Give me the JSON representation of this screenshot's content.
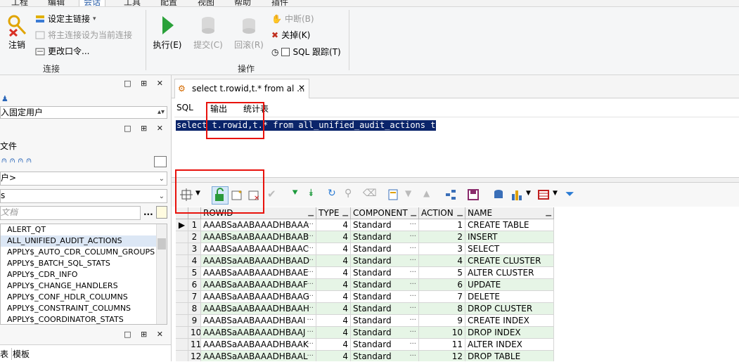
{
  "menu": [
    "工程",
    "编辑",
    "会话",
    "工具",
    "配置",
    "视图",
    "帮助",
    "插件"
  ],
  "menu_active": "会话",
  "ribbon": {
    "connection_group": "连接",
    "logoff": "注销",
    "set_primary": "设定主链接",
    "set_primary_as_current": "将主连接设为当前连接",
    "change_password": "更改口令...",
    "operations_group": "操作",
    "execute": "执行(E)",
    "commit": "提交(C)",
    "rollback": "回滚(R)",
    "break": "中断(B)",
    "close": "关掉(K)",
    "sql_trace": "SQL 跟踪(T)"
  },
  "left": {
    "fixed_user": "入固定用户",
    "files_label": "文件",
    "user_combo": "户>",
    "type_combo": "s",
    "search_placeholder": "文档",
    "objects": [
      "ALERT_QT",
      "ALL_UNIFIED_AUDIT_ACTIONS",
      "APPLY$_AUTO_CDR_COLUMN_GROUPS",
      "APPLY$_BATCH_SQL_STATS",
      "APPLY$_CDR_INFO",
      "APPLY$_CHANGE_HANDLERS",
      "APPLY$_CONF_HDLR_COLUMNS",
      "APPLY$_CONSTRAINT_COLUMNS",
      "APPLY$_COORDINATOR_STATS"
    ],
    "bottom_tab1": "表",
    "bottom_tab2": "模板"
  },
  "editor": {
    "tab_title": "select t.rowid,t.* from al ...",
    "subtab_sql": "SQL",
    "subtab_output": "输出",
    "subtab_stats": "统计表",
    "sql": "select t.rowid,t.* from all_unified_audit_actions t"
  },
  "grid": {
    "columns": [
      "ROWID",
      "TYPE",
      "COMPONENT",
      "ACTION",
      "NAME"
    ],
    "rows": [
      [
        "1",
        "AAABSaAABAAADHBAAA",
        "4",
        "Standard",
        "1",
        "CREATE TABLE"
      ],
      [
        "2",
        "AAABSaAABAAADHBAAB",
        "4",
        "Standard",
        "2",
        "INSERT"
      ],
      [
        "3",
        "AAABSaAABAAADHBAAC",
        "4",
        "Standard",
        "3",
        "SELECT"
      ],
      [
        "4",
        "AAABSaAABAAADHBAAD",
        "4",
        "Standard",
        "4",
        "CREATE CLUSTER"
      ],
      [
        "5",
        "AAABSaAABAAADHBAAE",
        "4",
        "Standard",
        "5",
        "ALTER CLUSTER"
      ],
      [
        "6",
        "AAABSaAABAAADHBAAF",
        "4",
        "Standard",
        "6",
        "UPDATE"
      ],
      [
        "7",
        "AAABSaAABAAADHBAAG",
        "4",
        "Standard",
        "7",
        "DELETE"
      ],
      [
        "8",
        "AAABSaAABAAADHBAAH",
        "4",
        "Standard",
        "8",
        "DROP CLUSTER"
      ],
      [
        "9",
        "AAABSaAABAAADHBAAI",
        "4",
        "Standard",
        "9",
        "CREATE INDEX"
      ],
      [
        "10",
        "AAABSaAABAAADHBAAJ",
        "4",
        "Standard",
        "10",
        "DROP INDEX"
      ],
      [
        "11",
        "AAABSaAABAAADHBAAK",
        "4",
        "Standard",
        "11",
        "ALTER INDEX"
      ],
      [
        "12",
        "AAABSaAABAAADHBAAL",
        "4",
        "Standard",
        "12",
        "DROP TABLE"
      ]
    ]
  },
  "colors": {
    "selection": "#0a246a",
    "alt_row": "#e6f5e6",
    "annotation": "#e8120c"
  }
}
